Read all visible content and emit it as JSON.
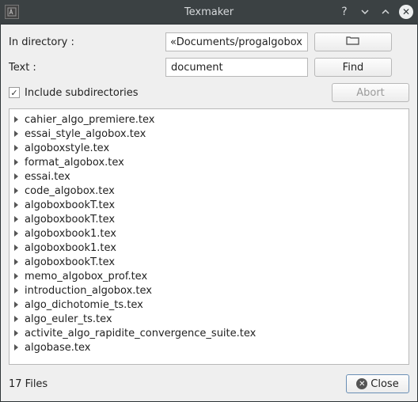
{
  "title": "Texmaker",
  "labels": {
    "in_directory": "In directory :",
    "text": "Text :"
  },
  "inputs": {
    "directory": "«Documents/progalgobox",
    "text": "document"
  },
  "buttons": {
    "find": "Find",
    "abort": "Abort",
    "close": "Close"
  },
  "checkbox": {
    "include_subdirs": "Include subdirectories",
    "checked": true
  },
  "results": [
    "cahier_algo_premiere.tex",
    "essai_style_algobox.tex",
    "algoboxstyle.tex",
    "format_algobox.tex",
    "essai.tex",
    "code_algobox.tex",
    "algoboxbookT.tex",
    "algoboxbookT.tex",
    "algoboxbook1.tex",
    "algoboxbook1.tex",
    "algoboxbookT.tex",
    "memo_algobox_prof.tex",
    "introduction_algobox.tex",
    "algo_dichotomie_ts.tex",
    "algo_euler_ts.tex",
    "activite_algo_rapidite_convergence_suite.tex",
    "algobase.tex"
  ],
  "status": "17 Files"
}
